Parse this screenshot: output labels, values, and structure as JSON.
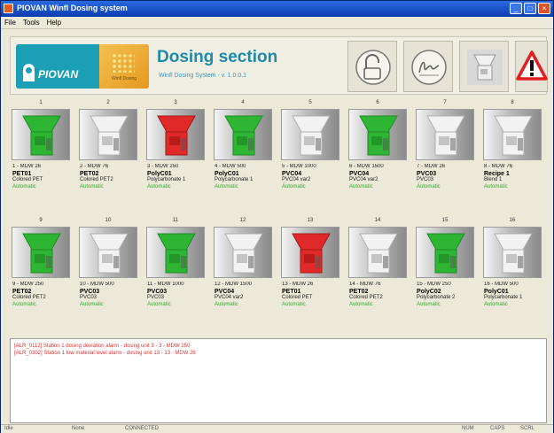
{
  "window": {
    "title": "PIOVAN Winfl Dosing system",
    "menu": [
      "File",
      "Tools",
      "Help"
    ],
    "controls": [
      "minimize-icon",
      "maximize-icon",
      "close-icon"
    ]
  },
  "header": {
    "logo_text": "PIOVAN",
    "logo_tile_text": "Winfl Dosing",
    "title": "Dosing section",
    "subtitle": "Winfl Dosing System - v. 1.0.0.1",
    "buttons": [
      {
        "icon": "unlock-icon"
      },
      {
        "icon": "signature-icon"
      },
      {
        "icon": "dosing-units-icon"
      },
      {
        "icon": "alarm-warning-icon",
        "color": "#e02020"
      }
    ]
  },
  "colors": {
    "active_green": "#2fb534",
    "alarm_red": "#e03030",
    "status_green": "#35a835",
    "accent_teal": "#1d8aa8"
  },
  "units": [
    {
      "num": "1",
      "line1": "1 - MDW 26",
      "line2": "PET01",
      "line3": "Colored PET",
      "status": "Automatic",
      "state": "green"
    },
    {
      "num": "2",
      "line1": "2 - MDW 76",
      "line2": "PET02",
      "line3": "Colored PET2",
      "status": "Automatic",
      "state": "gray"
    },
    {
      "num": "3",
      "line1": "3 - MDW 250",
      "line2": "PolyC01",
      "line3": "Polycarbonate 1",
      "status": "Automatic",
      "state": "red"
    },
    {
      "num": "4",
      "line1": "4 - MDW 500",
      "line2": "PolyC01",
      "line3": "Polycarbonate 1",
      "status": "Automatic",
      "state": "green"
    },
    {
      "num": "5",
      "line1": "5 - MDW 1000",
      "line2": "PVC04",
      "line3": "PVC04 var2",
      "status": "Automatic",
      "state": "gray"
    },
    {
      "num": "6",
      "line1": "6 - MDW 1500",
      "line2": "PVC04",
      "line3": "PVC04 var2",
      "status": "Automatic",
      "state": "green"
    },
    {
      "num": "7",
      "line1": "7 - MDW 26",
      "line2": "PVC03",
      "line3": "PVC03",
      "status": "Automatic",
      "state": "gray"
    },
    {
      "num": "8",
      "line1": "8 - MDW 76",
      "line2": "Recipe 1",
      "line3": "Blend 1",
      "status": "Automatic",
      "state": "gray"
    },
    {
      "num": "9",
      "line1": "9 - MDW 250",
      "line2": "PET02",
      "line3": "Colored PET2",
      "status": "Automatic",
      "state": "green"
    },
    {
      "num": "10",
      "line1": "10 - MDW 500",
      "line2": "PVC03",
      "line3": "PVC03",
      "status": "Automatic",
      "state": "gray"
    },
    {
      "num": "11",
      "line1": "11 - MDW 1000",
      "line2": "PVC03",
      "line3": "PVC03",
      "status": "Automatic",
      "state": "green"
    },
    {
      "num": "12",
      "line1": "12 - MDW 1500",
      "line2": "PVC04",
      "line3": "PVC04 var2",
      "status": "Automatic",
      "state": "gray"
    },
    {
      "num": "13",
      "line1": "13 - MDW 26",
      "line2": "PET01",
      "line3": "Colored PET",
      "status": "Automatic",
      "state": "red"
    },
    {
      "num": "14",
      "line1": "14 - MDW 76",
      "line2": "PET02",
      "line3": "Colored PET2",
      "status": "Automatic",
      "state": "gray"
    },
    {
      "num": "15",
      "line1": "15 - MDW 250",
      "line2": "PolyC02",
      "line3": "Polycarbonate 2",
      "status": "Automatic",
      "state": "green"
    },
    {
      "num": "16",
      "line1": "16 - MDW 500",
      "line2": "PolyC01",
      "line3": "Polycarbonate 1",
      "status": "Automatic",
      "state": "gray"
    }
  ],
  "alarms": [
    "[ALR_0112] Station 1 dosing deviation alarm - dosing unit 3 - 3 - MDW 250",
    "[ALR_0302] Station 1 low material level alarm - dosing unit 13 - 13 - MDW 26"
  ],
  "statusbar": [
    "Idle",
    "None",
    "CONNECTED",
    "NUM",
    "CAPS",
    "SCRL"
  ]
}
